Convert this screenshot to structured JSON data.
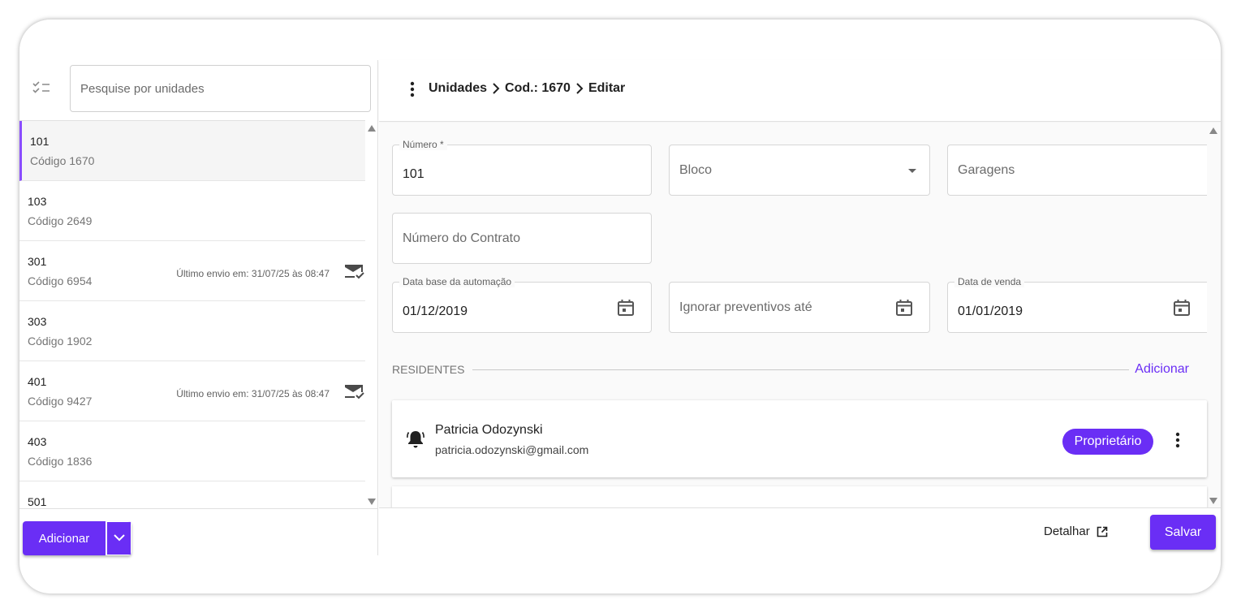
{
  "search": {
    "placeholder": "Pesquise por unidades"
  },
  "units": [
    {
      "number": "101",
      "code": "Código 1670",
      "sent": "",
      "selected": true
    },
    {
      "number": "103",
      "code": "Código 2649",
      "sent": ""
    },
    {
      "number": "301",
      "code": "Código 6954",
      "sent": "Último envio em: 31/07/25 às 08:47"
    },
    {
      "number": "303",
      "code": "Código 1902",
      "sent": ""
    },
    {
      "number": "401",
      "code": "Código 9427",
      "sent": "Último envio em: 31/07/25 às 08:47"
    },
    {
      "number": "403",
      "code": "Código 1836",
      "sent": ""
    },
    {
      "number": "501",
      "code": "",
      "sent": ""
    }
  ],
  "left_footer": {
    "add_label": "Adicionar"
  },
  "breadcrumb": {
    "item1": "Unidades",
    "item2": "Cod.: 1670",
    "item3": "Editar"
  },
  "form": {
    "numero_label": "Número *",
    "numero_value": "101",
    "bloco_placeholder": "Bloco",
    "garagens_placeholder": "Garagens",
    "contrato_placeholder": "Número do Contrato",
    "data_base_label": "Data base da automação",
    "data_base_value": "01/12/2019",
    "ignorar_placeholder": "Ignorar preventivos até",
    "data_venda_label": "Data de venda",
    "data_venda_value": "01/01/2019"
  },
  "residents": {
    "section_label": "RESIDENTES",
    "add_label": "Adicionar",
    "items": [
      {
        "name": "Patricia Odozynski",
        "email": "patricia.odozynski@gmail.com",
        "role": "Proprietário"
      }
    ]
  },
  "footer": {
    "detail_label": "Detalhar",
    "save_label": "Salvar"
  },
  "colors": {
    "accent": "#6a2ef5",
    "selected_bar": "#8a4dff"
  }
}
